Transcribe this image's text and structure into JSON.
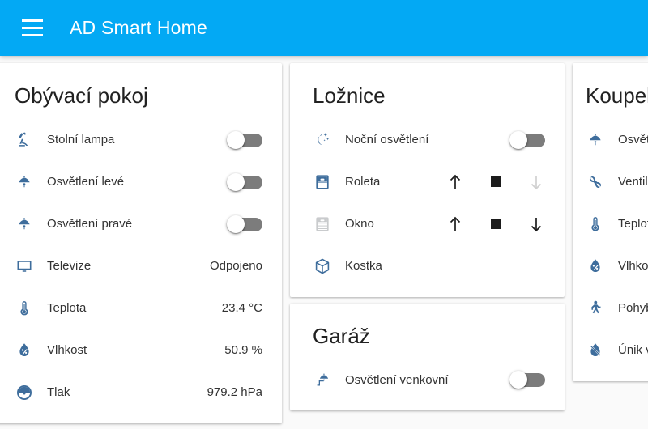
{
  "header": {
    "menu_icon": "hamburger-menu-icon",
    "title": "AD Smart Home"
  },
  "cards": [
    {
      "id": "obyvaci-pokoj",
      "title": "Obývací pokoj",
      "rows": [
        {
          "icon": "desk-lamp-icon",
          "label": "Stolní lampa",
          "control": "toggle",
          "state": "off"
        },
        {
          "icon": "ceiling-light-icon",
          "label": "Osvětlení levé",
          "control": "toggle",
          "state": "off"
        },
        {
          "icon": "ceiling-light-icon",
          "label": "Osvětlení pravé",
          "control": "toggle",
          "state": "off"
        },
        {
          "icon": "television-icon",
          "label": "Televize",
          "control": "value",
          "value": "Odpojeno"
        },
        {
          "icon": "thermometer-icon",
          "label": "Teplota",
          "control": "value",
          "value": "23.4 °C"
        },
        {
          "icon": "humidity-icon",
          "label": "Vlhkost",
          "control": "value",
          "value": "50.9 %"
        },
        {
          "icon": "gauge-icon",
          "label": "Tlak",
          "control": "value",
          "value": "979.2 hPa"
        }
      ]
    },
    {
      "id": "loznice",
      "title": "Ložnice",
      "rows": [
        {
          "icon": "night-light-moon-icon",
          "label": "Noční osvětlení",
          "control": "toggle",
          "state": "off"
        },
        {
          "icon": "blind-icon",
          "label": "Roleta",
          "control": "cover",
          "up": "enabled",
          "stop": "enabled",
          "down": "disabled"
        },
        {
          "icon": "window-icon",
          "label": "Okno",
          "control": "cover",
          "up": "enabled",
          "stop": "enabled",
          "down": "enabled"
        },
        {
          "icon": "cube-icon",
          "label": "Kostka",
          "control": "none"
        }
      ]
    },
    {
      "id": "garaz",
      "title": "Garáž",
      "rows": [
        {
          "icon": "outdoor-light-icon",
          "label": "Osvětlení venkovní",
          "control": "toggle",
          "state": "off"
        }
      ]
    },
    {
      "id": "koupelna",
      "title": "Koupelna",
      "rows": [
        {
          "icon": "ceiling-light-icon",
          "label": "Osvětlení"
        },
        {
          "icon": "fan-icon",
          "label": "Ventilátor"
        },
        {
          "icon": "thermometer-icon",
          "label": "Teplota"
        },
        {
          "icon": "humidity-icon",
          "label": "Vlhkost"
        },
        {
          "icon": "motion-sensor-icon",
          "label": "Pohyb"
        },
        {
          "icon": "leak-sensor-icon",
          "label": "Únik vody"
        }
      ]
    }
  ],
  "colors": {
    "appbar": "#03a9f4",
    "icon_blue": "#3e6d9c",
    "icon_grey": "#c9cbcd",
    "toggle_track_off": "#7c7c7c",
    "page_bg": "#fafafa",
    "card_bg": "#ffffff",
    "text": "#333333"
  }
}
